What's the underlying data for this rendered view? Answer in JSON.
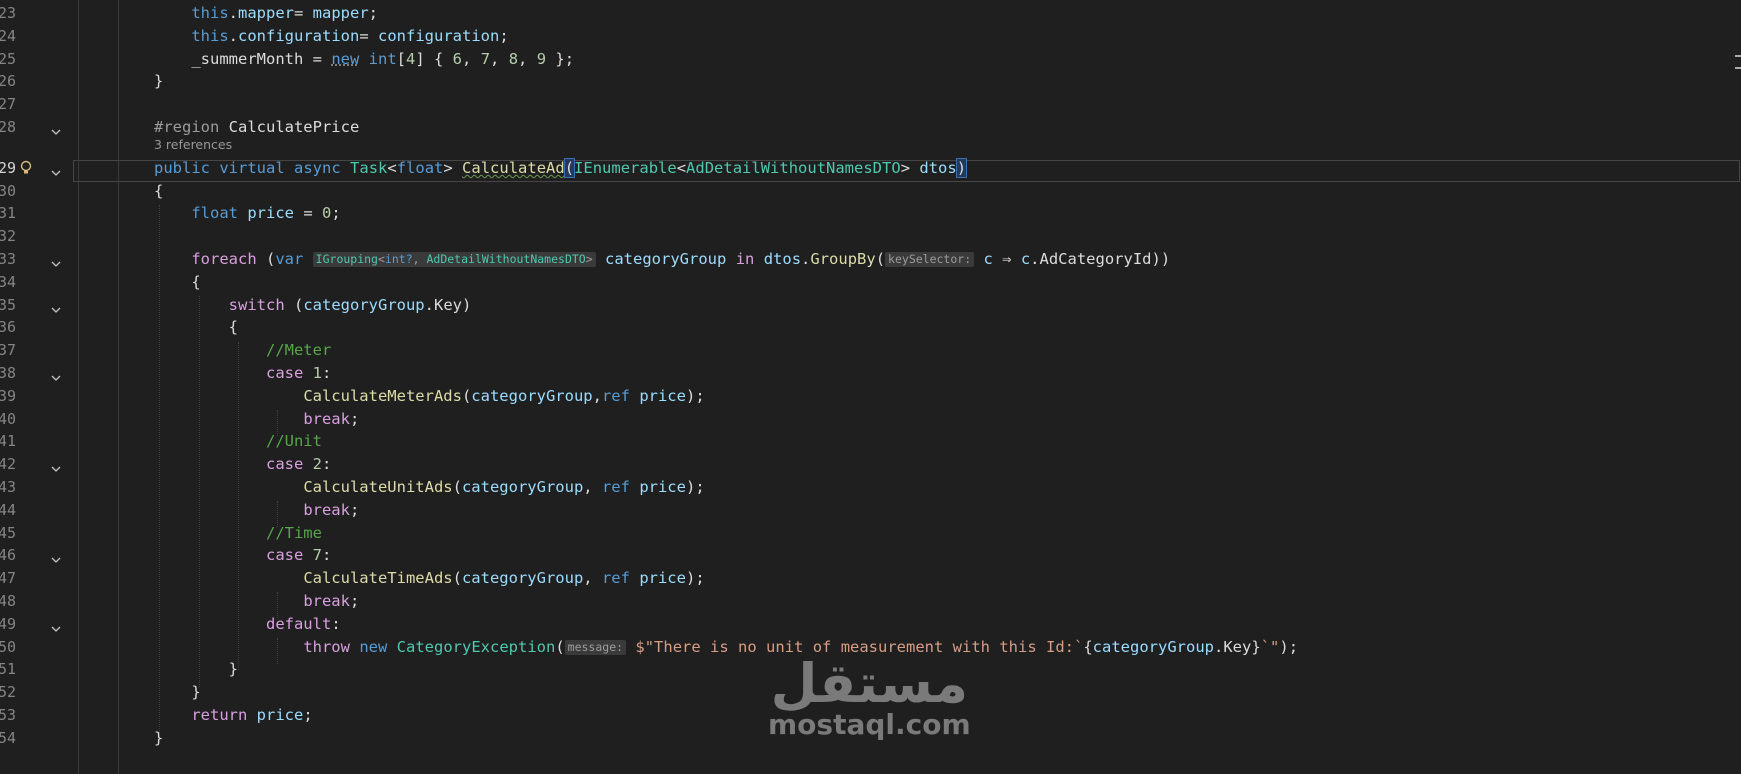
{
  "editor": {
    "references_label": "3 references",
    "lines": [
      {
        "n": "23",
        "tokens": [
          [
            "    ",
            ""
          ],
          [
            "this",
            "kw"
          ],
          [
            ".",
            "plain"
          ],
          [
            "mapper",
            "var"
          ],
          [
            "= ",
            "plain"
          ],
          [
            "mapper",
            "var"
          ],
          [
            ";",
            "plain"
          ]
        ]
      },
      {
        "n": "24",
        "tokens": [
          [
            "    ",
            ""
          ],
          [
            "this",
            "kw"
          ],
          [
            ".",
            "plain"
          ],
          [
            "configuration",
            "var"
          ],
          [
            "= ",
            "plain"
          ],
          [
            "configuration",
            "var"
          ],
          [
            ";",
            "plain"
          ]
        ]
      },
      {
        "n": "25",
        "tokens": [
          [
            "    ",
            ""
          ],
          [
            "_summerMonth",
            "plain"
          ],
          [
            " = ",
            "plain"
          ],
          [
            "new",
            "kw dots"
          ],
          [
            " ",
            "plain"
          ],
          [
            "int",
            "kw"
          ],
          [
            "[",
            "plain"
          ],
          [
            "4",
            "num"
          ],
          [
            "] { ",
            "plain"
          ],
          [
            "6",
            "num"
          ],
          [
            ", ",
            "plain"
          ],
          [
            "7",
            "num"
          ],
          [
            ", ",
            "plain"
          ],
          [
            "8",
            "num"
          ],
          [
            ", ",
            "plain"
          ],
          [
            "9",
            "num"
          ],
          [
            " };",
            "plain"
          ]
        ]
      },
      {
        "n": "26",
        "tokens": [
          [
            "}",
            "plain"
          ]
        ]
      },
      {
        "n": "27",
        "tokens": []
      },
      {
        "n": "28",
        "fold": true,
        "tokens": [
          [
            "#region ",
            "pre"
          ],
          [
            "CalculatePrice",
            "plain"
          ]
        ]
      },
      {
        "n": "29",
        "fold": true,
        "bulb": true,
        "active": true,
        "tokens": [
          [
            "public",
            "kw"
          ],
          [
            " ",
            "plain"
          ],
          [
            "virtual",
            "kw"
          ],
          [
            " ",
            "plain"
          ],
          [
            "async",
            "kw"
          ],
          [
            " ",
            "plain"
          ],
          [
            "Task",
            "type"
          ],
          [
            "<",
            "plain"
          ],
          [
            "float",
            "kw"
          ],
          [
            "> ",
            "plain"
          ],
          [
            "CalculateAd",
            "fn sq"
          ],
          [
            "(",
            "plain bracehl"
          ],
          [
            "IEnumerable",
            "type"
          ],
          [
            "<",
            "plain"
          ],
          [
            "AdDetailWithoutNamesDTO",
            "type"
          ],
          [
            "> ",
            "plain"
          ],
          [
            "dtos",
            "var"
          ],
          [
            ")",
            "plain bracehl"
          ]
        ]
      },
      {
        "n": "30",
        "tokens": [
          [
            "{",
            "plain"
          ]
        ]
      },
      {
        "n": "31",
        "tokens": [
          [
            "    ",
            ""
          ],
          [
            "float",
            "kw"
          ],
          [
            " ",
            "plain"
          ],
          [
            "price",
            "var"
          ],
          [
            " = ",
            "plain"
          ],
          [
            "0",
            "num"
          ],
          [
            ";",
            "plain"
          ]
        ]
      },
      {
        "n": "32",
        "tokens": []
      },
      {
        "n": "33",
        "fold": true,
        "tokens": [
          [
            "    ",
            ""
          ],
          [
            "foreach",
            "ctl"
          ],
          [
            " (",
            "plain"
          ],
          [
            "var",
            "kw"
          ],
          [
            " ",
            "plain"
          ],
          [
            "HINT_IGROUPING",
            "hint"
          ],
          [
            " ",
            "plain"
          ],
          [
            "categoryGroup",
            "var"
          ],
          [
            " ",
            "plain"
          ],
          [
            "in",
            "ctl"
          ],
          [
            " ",
            "plain"
          ],
          [
            "dtos",
            "var"
          ],
          [
            ".",
            "plain"
          ],
          [
            "GroupBy",
            "fn"
          ],
          [
            "(",
            "plain"
          ],
          [
            "keySelector:",
            "hint"
          ],
          [
            " ",
            "plain"
          ],
          [
            "c",
            "var"
          ],
          [
            " ⇒ ",
            "plain"
          ],
          [
            "c",
            "var"
          ],
          [
            ".",
            "plain"
          ],
          [
            "AdCategoryId",
            "plain"
          ],
          [
            "))",
            "plain"
          ]
        ]
      },
      {
        "n": "34",
        "tokens": [
          [
            "    ",
            ""
          ],
          [
            "{",
            "plain"
          ]
        ]
      },
      {
        "n": "35",
        "fold": true,
        "tokens": [
          [
            "        ",
            ""
          ],
          [
            "switch",
            "ctl"
          ],
          [
            " (",
            "plain"
          ],
          [
            "categoryGroup",
            "var"
          ],
          [
            ".",
            "plain"
          ],
          [
            "Key",
            "plain"
          ],
          [
            ")",
            "plain"
          ]
        ]
      },
      {
        "n": "36",
        "tokens": [
          [
            "        ",
            ""
          ],
          [
            "{",
            "plain"
          ]
        ]
      },
      {
        "n": "37",
        "tokens": [
          [
            "            ",
            ""
          ],
          [
            "//Meter",
            "cm"
          ]
        ]
      },
      {
        "n": "38",
        "fold": true,
        "tokens": [
          [
            "            ",
            ""
          ],
          [
            "case",
            "ctl"
          ],
          [
            " ",
            "plain"
          ],
          [
            "1",
            "num"
          ],
          [
            ":",
            "plain"
          ]
        ]
      },
      {
        "n": "39",
        "tokens": [
          [
            "                ",
            ""
          ],
          [
            "CalculateMeterAds",
            "fn"
          ],
          [
            "(",
            "plain"
          ],
          [
            "categoryGroup",
            "var"
          ],
          [
            ",",
            "plain"
          ],
          [
            "ref",
            "kw"
          ],
          [
            " ",
            "plain"
          ],
          [
            "price",
            "var"
          ],
          [
            ");",
            "plain"
          ]
        ]
      },
      {
        "n": "40",
        "tokens": [
          [
            "                ",
            ""
          ],
          [
            "break",
            "ctl"
          ],
          [
            ";",
            "plain"
          ]
        ]
      },
      {
        "n": "41",
        "tokens": [
          [
            "            ",
            ""
          ],
          [
            "//Unit",
            "cm"
          ]
        ]
      },
      {
        "n": "42",
        "fold": true,
        "tokens": [
          [
            "            ",
            ""
          ],
          [
            "case",
            "ctl"
          ],
          [
            " ",
            "plain"
          ],
          [
            "2",
            "num"
          ],
          [
            ":",
            "plain"
          ]
        ]
      },
      {
        "n": "43",
        "tokens": [
          [
            "                ",
            ""
          ],
          [
            "CalculateUnitAds",
            "fn"
          ],
          [
            "(",
            "plain"
          ],
          [
            "categoryGroup",
            "var"
          ],
          [
            ", ",
            "plain"
          ],
          [
            "ref",
            "kw"
          ],
          [
            " ",
            "plain"
          ],
          [
            "price",
            "var"
          ],
          [
            ");",
            "plain"
          ]
        ]
      },
      {
        "n": "44",
        "tokens": [
          [
            "                ",
            ""
          ],
          [
            "break",
            "ctl"
          ],
          [
            ";",
            "plain"
          ]
        ]
      },
      {
        "n": "45",
        "tokens": [
          [
            "            ",
            ""
          ],
          [
            "//Time",
            "cm"
          ]
        ]
      },
      {
        "n": "46",
        "fold": true,
        "tokens": [
          [
            "            ",
            ""
          ],
          [
            "case",
            "ctl"
          ],
          [
            " ",
            "plain"
          ],
          [
            "7",
            "num"
          ],
          [
            ":",
            "plain"
          ]
        ]
      },
      {
        "n": "47",
        "tokens": [
          [
            "                ",
            ""
          ],
          [
            "CalculateTimeAds",
            "fn"
          ],
          [
            "(",
            "plain"
          ],
          [
            "categoryGroup",
            "var"
          ],
          [
            ", ",
            "plain"
          ],
          [
            "ref",
            "kw"
          ],
          [
            " ",
            "plain"
          ],
          [
            "price",
            "var"
          ],
          [
            ");",
            "plain"
          ]
        ]
      },
      {
        "n": "48",
        "tokens": [
          [
            "                ",
            ""
          ],
          [
            "break",
            "ctl"
          ],
          [
            ";",
            "plain"
          ]
        ]
      },
      {
        "n": "49",
        "fold": true,
        "tokens": [
          [
            "            ",
            ""
          ],
          [
            "default",
            "ctl"
          ],
          [
            ":",
            "plain"
          ]
        ]
      },
      {
        "n": "50",
        "tokens": [
          [
            "                ",
            ""
          ],
          [
            "throw",
            "ctl"
          ],
          [
            " ",
            "plain"
          ],
          [
            "new",
            "kw"
          ],
          [
            " ",
            "plain"
          ],
          [
            "CategoryException",
            "type"
          ],
          [
            "(",
            "plain"
          ],
          [
            "message:",
            "hint"
          ],
          [
            " ",
            "plain"
          ],
          [
            "$\"There is no unit of measurement with this Id:`",
            "str"
          ],
          [
            "{",
            "plain"
          ],
          [
            "categoryGroup",
            "var"
          ],
          [
            ".",
            "plain"
          ],
          [
            "Key",
            "plain"
          ],
          [
            "}",
            "plain"
          ],
          [
            "`\"",
            "str"
          ],
          [
            ");",
            "plain"
          ]
        ]
      },
      {
        "n": "51",
        "tokens": [
          [
            "        ",
            ""
          ],
          [
            "}",
            "plain"
          ]
        ]
      },
      {
        "n": "52",
        "tokens": [
          [
            "    ",
            ""
          ],
          [
            "}",
            "plain"
          ]
        ]
      },
      {
        "n": "53",
        "tokens": [
          [
            "    ",
            ""
          ],
          [
            "return",
            "ctl"
          ],
          [
            " ",
            "plain"
          ],
          [
            "price",
            "var"
          ],
          [
            ";",
            "plain"
          ]
        ]
      },
      {
        "n": "54",
        "tokens": [
          [
            "}",
            "plain"
          ]
        ]
      }
    ],
    "grouping_hint": {
      "prefix": "IGrouping<",
      "t1": "int?",
      "sep": ", ",
      "t2": "AdDetailWithoutNamesDTO",
      "suffix": ">"
    }
  },
  "watermark": {
    "arabic": "مستقل",
    "latin": "mostaql.com"
  },
  "colors": {
    "background": "#1f1f1f",
    "keyword": "#569cd6",
    "control": "#d8a0df",
    "type": "#4ec9b0",
    "method": "#dcdcaa",
    "variable": "#9cdcfe",
    "number": "#b5cea8",
    "string": "#d69d85",
    "comment": "#57a64a"
  }
}
